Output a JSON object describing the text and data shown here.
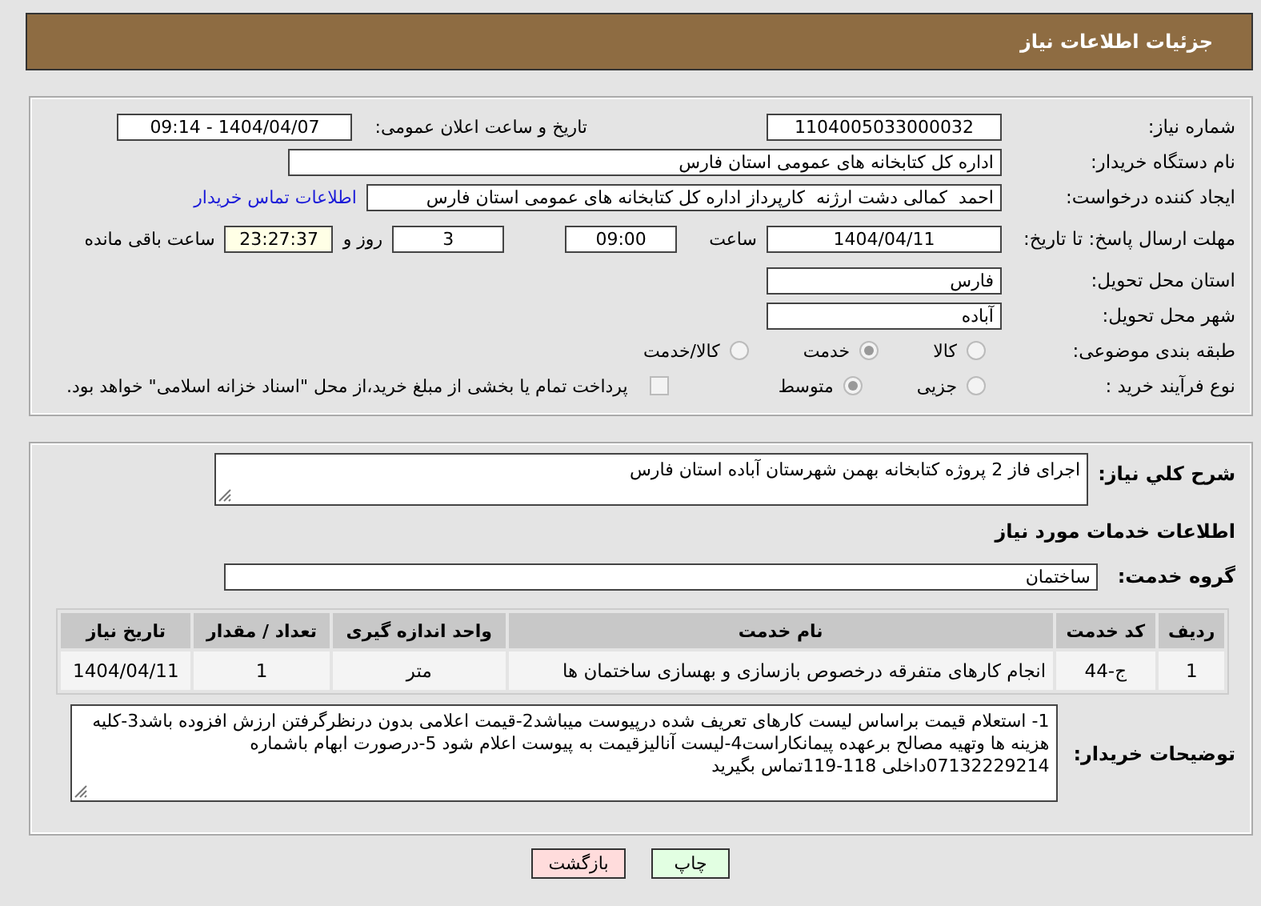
{
  "header": {
    "title": "جزئیات اطلاعات نیاز"
  },
  "details": {
    "need_number": {
      "label": "شماره نیاز:",
      "value": "1104005033000032"
    },
    "announce": {
      "label": "تاریخ و ساعت اعلان عمومی:",
      "value": "1404/04/07 - 09:14"
    },
    "buyer": {
      "label": "نام دستگاه خریدار:",
      "value": "اداره کل کتابخانه های عمومی استان فارس"
    },
    "creator": {
      "label": "ایجاد کننده درخواست:",
      "value": "احمد  کمالی دشت ارژنه  کارپرداز اداره کل کتابخانه های عمومی استان فارس",
      "link": "اطلاعات تماس خریدار"
    },
    "deadline": {
      "label": "مهلت ارسال پاسخ: تا تاریخ:",
      "date": "1404/04/11",
      "time_label": "ساعت",
      "time": "09:00",
      "days": "3",
      "days_label": "روز و",
      "remaining": "23:27:37",
      "remaining_label": "ساعت باقی مانده"
    },
    "province": {
      "label": "استان محل تحویل:",
      "value": "فارس"
    },
    "city": {
      "label": "شهر محل تحویل:",
      "value": "آباده"
    },
    "category": {
      "label": "طبقه بندی موضوعی:",
      "options": [
        {
          "label": "کالا",
          "selected": false
        },
        {
          "label": "خدمت",
          "selected": true
        },
        {
          "label": "کالا/خدمت",
          "selected": false
        }
      ]
    },
    "process": {
      "label": "نوع فرآیند خرید :",
      "options": [
        {
          "label": "جزیی",
          "selected": false
        },
        {
          "label": "متوسط",
          "selected": true
        }
      ],
      "treasury": {
        "label": "پرداخت تمام یا بخشی از مبلغ خرید،از محل \"اسناد خزانه اسلامی\" خواهد بود.",
        "checked": false
      }
    }
  },
  "summary": {
    "label": "شرح کلي نیاز:",
    "value": "اجرای فاز 2 پروژه کتابخانه بهمن شهرستان آباده استان فارس"
  },
  "services": {
    "title": "اطلاعات خدمات مورد نیاز",
    "group_label": "گروه خدمت:",
    "group": "ساختمان",
    "table": {
      "columns": [
        "ردیف",
        "کد خدمت",
        "نام خدمت",
        "واحد اندازه گیری",
        "تعداد / مقدار",
        "تاریخ نیاز"
      ],
      "rows": [
        [
          "1",
          "ج-44",
          "انجام کارهای متفرقه درخصوص بازسازی و بهسازی ساختمان ها",
          "متر",
          "1",
          "1404/04/11"
        ]
      ]
    }
  },
  "notes": {
    "label": "توضیحات خریدار:",
    "value": "1- استعلام قیمت براساس لیست کارهای تعریف شده درپیوست میباشد2-قیمت اعلامی بدون درنظرگرفتن ارزش افزوده باشد3-کلیه هزینه ها وتهیه مصالح برعهده پیمانکاراست4-لیست آنالیزقیمت به پیوست اعلام شود 5-درصورت ابهام باشماره 07132229214داخلی 118-119تماس بگیرید"
  },
  "buttons": [
    {
      "label": "چاپ",
      "kind": "print"
    },
    {
      "label": "بازگشت",
      "kind": "back"
    }
  ]
}
